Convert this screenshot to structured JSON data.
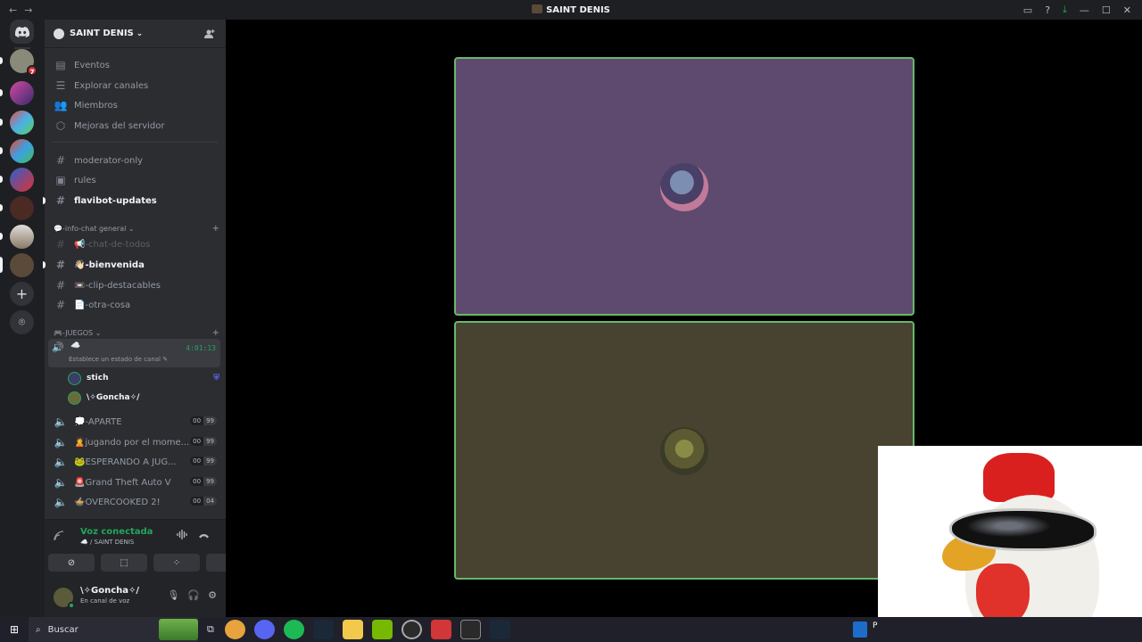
{
  "window": {
    "title": "SAINT DENIS",
    "nav_back": "←",
    "nav_forward": "→",
    "controls": [
      "▭",
      "?",
      "⤓",
      "—",
      "☐",
      "✕"
    ]
  },
  "server_list": {
    "home_icon": "discord-logo-icon",
    "badge_count": "7",
    "add_icon": "+",
    "discover_icon": "⌾",
    "accent_color": "#23a55a"
  },
  "server": {
    "name": "SAINT DENIS",
    "chevron": "⌄",
    "invite_icon": "person-add-icon"
  },
  "nav": [
    {
      "icon": "calendar-icon",
      "glyph": "▤",
      "label": "Eventos"
    },
    {
      "icon": "browse-icon",
      "glyph": "☰",
      "label": "Explorar canales"
    },
    {
      "icon": "members-icon",
      "glyph": "👥",
      "label": "Miembros"
    },
    {
      "icon": "boost-icon",
      "glyph": "⬡",
      "label": "Mejoras del servidor"
    }
  ],
  "channels_top": [
    {
      "glyph": "#",
      "label": "moderator-only"
    },
    {
      "glyph": "▣",
      "label": "rules"
    },
    {
      "glyph": "#",
      "label": "flavibot-updates"
    }
  ],
  "category_info": {
    "label": "💬-info-chat general ⌄",
    "plus": "+"
  },
  "channels_info": [
    {
      "glyph": "#",
      "label": "📢-chat-de-todos"
    },
    {
      "glyph": "#",
      "label": "👋🏻-bienvenida"
    },
    {
      "glyph": "#",
      "label": "📼-clip-destacables"
    },
    {
      "glyph": "#",
      "label": "📄-otra-cosa"
    }
  ],
  "category_games": {
    "label": "🎮-JUEGOS ⌄",
    "plus": "+"
  },
  "active_voice": {
    "speaker": "🔊",
    "name": "☁️",
    "timer": "4:01:13",
    "status": "Establece un estado de canal ✎"
  },
  "voice_users": [
    {
      "name": "stich",
      "badge": "⛨"
    },
    {
      "name": "\\✧Goncha✧/",
      "badge": ""
    }
  ],
  "voice_channels": [
    {
      "label": "💭-APARTE",
      "count": "00",
      "limit": "99"
    },
    {
      "label": "🙎jugando por el mome...",
      "count": "00",
      "limit": "99"
    },
    {
      "label": "🐸ESPERANDO A JUG...",
      "count": "00",
      "limit": "99"
    },
    {
      "label": "🚨Grand Theft Auto V",
      "count": "00",
      "limit": "99"
    },
    {
      "label": "🍲OVERCOOKED 2!",
      "count": "00",
      "limit": "04"
    }
  ],
  "voice_panel": {
    "status": "Voz conectada",
    "location": "☁️ / SAINT DENIS",
    "buttons": [
      "camera-off-icon",
      "screen-share-icon",
      "activities-icon",
      "soundboard-icon"
    ],
    "button_glyphs": [
      "⊘",
      "⬚",
      "⁘",
      "♫"
    ]
  },
  "user_panel": {
    "name": "\\✧Goncha✧/",
    "state": "En canal de voz",
    "mic": "🎙",
    "headset": "🎧",
    "settings": "⚙"
  },
  "taskbar": {
    "start": "⊞",
    "search_placeholder": "Buscar",
    "apps": [
      "chrome",
      "discord",
      "spotify",
      "steam",
      "files",
      "nvidia",
      "obs",
      "valorant",
      "epic",
      "steam-2"
    ],
    "app_colors": [
      "#e8a33d",
      "#5865f2",
      "#1db954",
      "#1b2838",
      "#f2c94c",
      "#76b900",
      "#2b2b2b",
      "#d13639",
      "#2a2a2a",
      "#1b2838"
    ],
    "tray_label": "P"
  }
}
